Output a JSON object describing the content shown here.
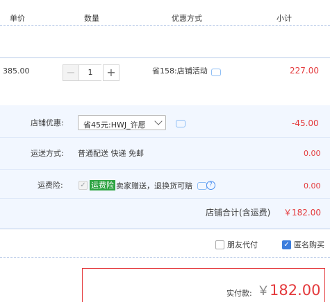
{
  "header": {
    "col_unit_price": "单价",
    "col_quantity": "数量",
    "col_discount": "优惠方式",
    "col_subtotal": "小计"
  },
  "item": {
    "unit_price": "385.00",
    "quantity": "1",
    "minus": "−",
    "plus": "+",
    "discount_text": "省158:店铺活动",
    "subtotal": "227.00"
  },
  "shop": {
    "coupon_label": "店铺优惠:",
    "coupon_selected": "省45元:HWJ_许愿",
    "coupon_amount": "-45.00",
    "shipping_label": "运送方式:",
    "shipping_value": "普通配送 快递 免邮",
    "shipping_amount": "0.00",
    "insurance_label": "运费险:",
    "insurance_badge": "运费险",
    "insurance_text": "卖家赠送，退换货可赔",
    "insurance_amount": "0.00",
    "total_label": "店铺合计(含运费)",
    "total_value": "￥182.00"
  },
  "options": {
    "friend_pay": "朋友代付",
    "anonymous": "匿名购买",
    "anonymous_checked": true
  },
  "payment": {
    "label": "实付款:",
    "currency": "￥",
    "amount": "182.00"
  },
  "colors": {
    "accent_red": "#e4393c",
    "panel_bg": "#f2f7ff",
    "checkbox_blue": "#3b7ddd",
    "badge_green": "#2ca341"
  },
  "icons": [
    "message-icon",
    "help-icon",
    "chevron-down-icon",
    "check-icon"
  ]
}
